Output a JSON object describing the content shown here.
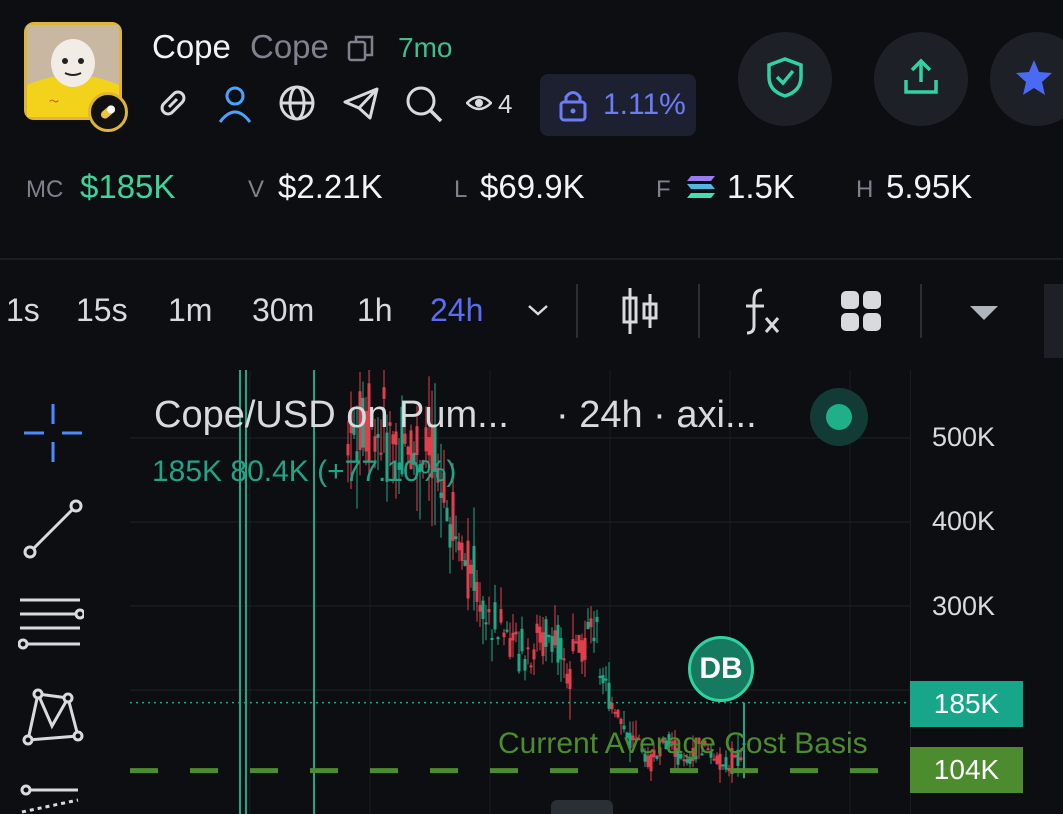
{
  "token": {
    "name": "Cope",
    "symbol": "Cope",
    "age": "7mo",
    "viewers": "4",
    "locked_pct": "1.11%"
  },
  "stats": {
    "mc_label": "MC",
    "mc_value": "$185K",
    "v_label": "V",
    "v_value": "$2.21K",
    "l_label": "L",
    "l_value": "$69.9K",
    "f_label": "F",
    "f_value": "1.5K",
    "h_label": "H",
    "h_value": "5.95K"
  },
  "timeframes": [
    "1s",
    "15s",
    "1m",
    "30m",
    "1h",
    "24h"
  ],
  "active_timeframe": "24h",
  "chart": {
    "title": "Cope/USD on Pum...",
    "timeframe_text": "· 24h · axi...",
    "ohlc_text": "185K  80.4K (+77.10%)",
    "marker_label": "DB",
    "cost_basis_label": "Current Average Cost Basis",
    "current_price_tag": "185K",
    "cost_basis_tag": "104K",
    "colors": {
      "up": "#1fa886",
      "down": "#e0404e",
      "cost_basis": "#4c8c2e",
      "accent": "#5b6cf5"
    }
  },
  "chart_data": {
    "type": "candlestick",
    "y_ticks": [
      "500K",
      "400K",
      "300K"
    ],
    "y_tick_values": [
      500000,
      400000,
      300000
    ],
    "current_price": 185000,
    "cost_basis": 104000
  },
  "icons": {
    "header": [
      "copy-icon",
      "link-icon",
      "user-icon",
      "globe-icon",
      "telegram-icon",
      "search-icon",
      "eye-icon",
      "lock-icon"
    ],
    "actions": [
      "shield-icon",
      "share-icon",
      "star-icon"
    ],
    "tools": [
      "crosshair-icon",
      "trendline-icon",
      "fib-icon",
      "pattern-icon",
      "ray-icon"
    ]
  }
}
